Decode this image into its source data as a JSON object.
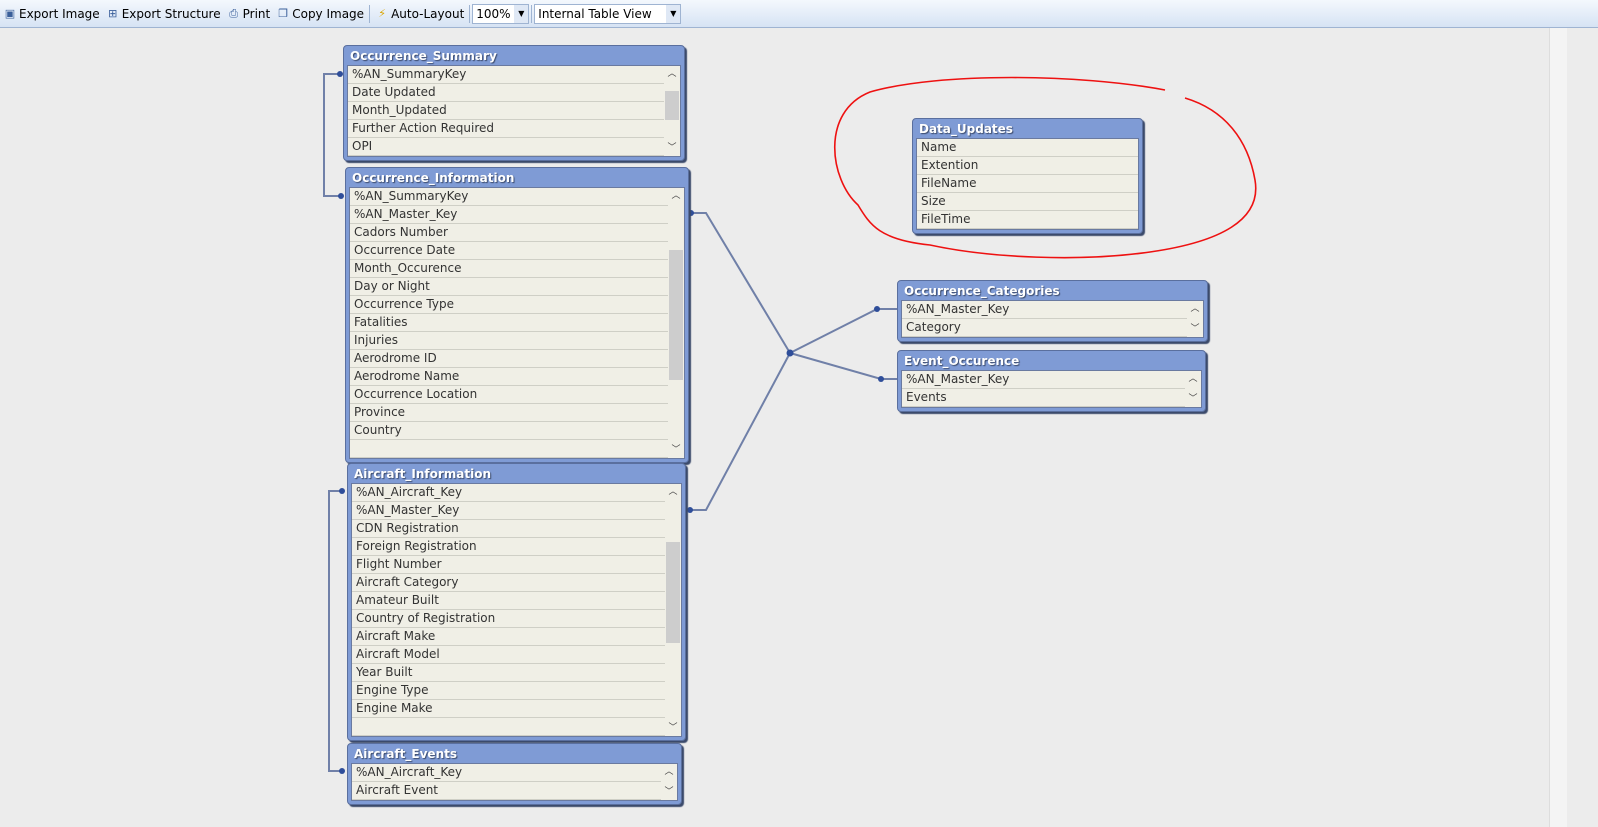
{
  "toolbar": {
    "export_image": "Export Image",
    "export_structure": "Export Structure",
    "print": "Print",
    "copy_image": "Copy Image",
    "auto_layout": "Auto-Layout",
    "zoom": "100%",
    "view": "Internal Table View"
  },
  "tables": [
    {
      "id": "occurrence-summary",
      "title": "Occurrence_Summary",
      "fields": [
        "%AN_SummaryKey",
        "Date Updated",
        "Month_Updated",
        "Further Action Required",
        "OPI"
      ],
      "scroll": true,
      "thumb": [
        0.12,
        0.4
      ]
    },
    {
      "id": "occurrence-information",
      "title": "Occurrence_Information",
      "fields": [
        "%AN_SummaryKey",
        "%AN_Master_Key",
        "Cadors Number",
        "Occurrence Date",
        "Month_Occurence",
        "Day or Night",
        "Occurrence Type",
        "Fatalities",
        "Injuries",
        "Aerodrome ID",
        "Aerodrome Name",
        "Occurrence Location",
        "Province",
        "Country",
        ""
      ],
      "scroll": true,
      "thumb": [
        0.07,
        0.6
      ]
    },
    {
      "id": "aircraft-information",
      "title": "Aircraft_Information",
      "fields": [
        "%AN_Aircraft_Key",
        "%AN_Master_Key",
        "CDN Registration",
        "Foreign Registration",
        "Flight Number",
        "Aircraft Category",
        "Amateur Built",
        "Country of Registration",
        "Aircraft Make",
        "Aircraft Model",
        "Year Built",
        "Engine Type",
        "Engine Make",
        ""
      ],
      "scroll": true,
      "thumb": [
        0.07,
        0.5
      ]
    },
    {
      "id": "aircraft-events",
      "title": "Aircraft_Events",
      "fields": [
        "%AN_Aircraft_Key",
        "Aircraft Event"
      ],
      "scroll": true
    },
    {
      "id": "data-updates",
      "title": "Data_Updates",
      "fields": [
        "Name",
        "Extention",
        "FileName",
        "Size",
        "FileTime"
      ],
      "scroll": false
    },
    {
      "id": "occurrence-categories",
      "title": "Occurrence_Categories",
      "fields": [
        "%AN_Master_Key",
        "Category"
      ],
      "scroll": true
    },
    {
      "id": "event-occurence",
      "title": "Event_Occurence",
      "fields": [
        "%AN_Master_Key",
        "Events"
      ],
      "scroll": true
    }
  ]
}
